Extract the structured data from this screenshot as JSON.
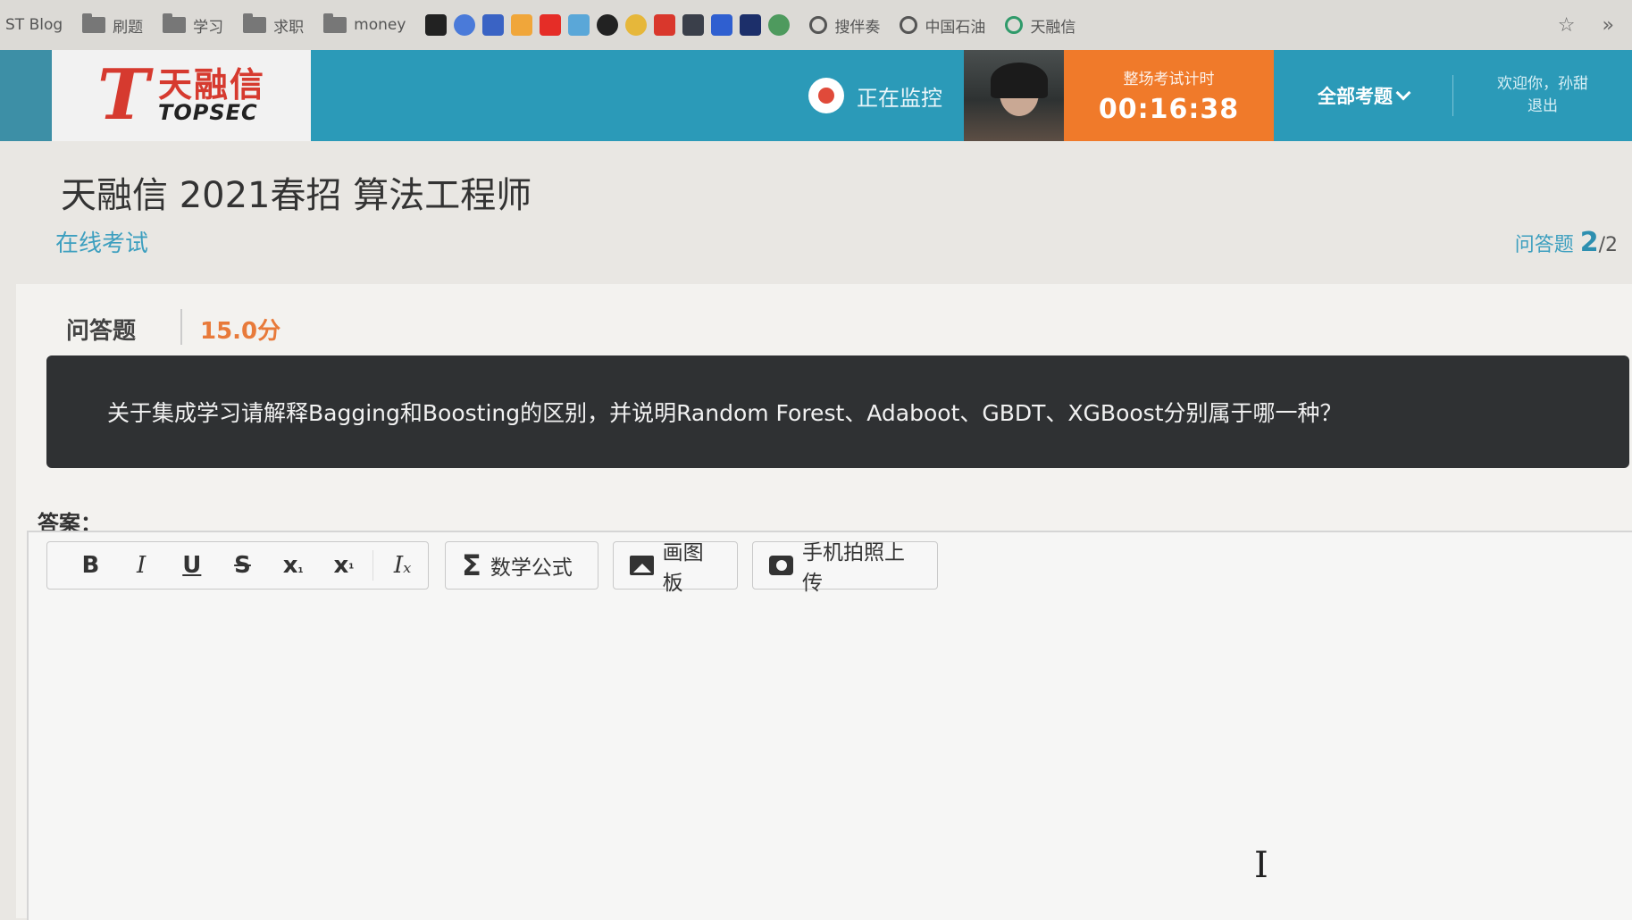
{
  "bookmarks": [
    {
      "type": "text",
      "label": "ST Blog"
    },
    {
      "type": "folder",
      "label": "刷题"
    },
    {
      "type": "folder",
      "label": "学习"
    },
    {
      "type": "folder",
      "label": "求职"
    },
    {
      "type": "folder",
      "label": "money"
    }
  ],
  "bookmark_sites": [
    {
      "label": "搜伴奏"
    },
    {
      "label": "中国石油"
    },
    {
      "label": "天融信"
    }
  ],
  "header": {
    "logo_mark": "T",
    "logo_cn": "天融信",
    "logo_en": "TOPSEC",
    "monitor_label": "正在监控",
    "timer_label": "整场考试计时",
    "timer_value": "00:16:38",
    "all_questions_label": "全部考题",
    "welcome": "欢迎你，孙甜",
    "logout": "退出"
  },
  "exam": {
    "title": "天融信 2021春招 算法工程师",
    "subtitle": "在线考试",
    "progress_type": "问答题",
    "progress_current": "2",
    "progress_total": "/2"
  },
  "question": {
    "type": "问答题",
    "score": "15.0分",
    "text": "关于集成学习请解释Bagging和Boosting的区别，并说明Random Forest、Adaboot、GBDT、XGBoost分别属于哪一种？"
  },
  "answer": {
    "label": "答案：",
    "toolbar": {
      "bold": "B",
      "italic": "I",
      "underline": "U",
      "strike": "S",
      "subscript": "x",
      "subscript_small": "₁",
      "superscript": "x",
      "superscript_small": "¹",
      "clear_format": "Iₓ",
      "math_label": "数学公式",
      "sigma": "Σ",
      "draw_label": "画图板",
      "photo_label": "手机拍照上传"
    }
  }
}
